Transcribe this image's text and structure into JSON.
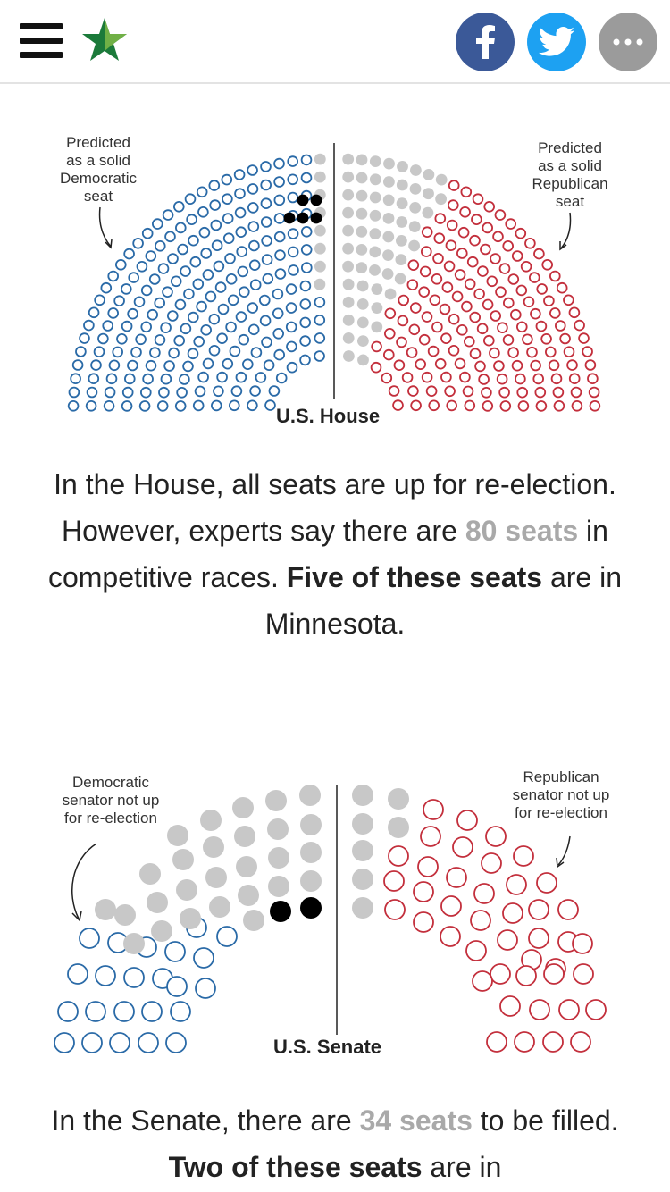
{
  "header": {
    "menu_icon": "hamburger-menu-icon",
    "logo_icon": "star-logo-icon",
    "share_buttons": [
      {
        "name": "facebook",
        "icon": "facebook-icon",
        "color": "#3b5998"
      },
      {
        "name": "twitter",
        "icon": "twitter-icon",
        "color": "#1da1f2"
      },
      {
        "name": "more",
        "icon": "more-icon",
        "color": "#9b9b9b"
      }
    ]
  },
  "colors": {
    "democrat": "#2a6aa7",
    "republican": "#c32f3c",
    "uncontested_blue_red": "#ffffff",
    "competitive": "#c8c8c8",
    "minnesota": "#000000"
  },
  "house": {
    "label": "U.S. House",
    "annotation_left": [
      "Predicted",
      "as a solid",
      "Democratic",
      "seat"
    ],
    "annotation_right": [
      "Predicted",
      "as a solid",
      "Republican",
      "seat"
    ],
    "seat_counts": {
      "democratic": 203,
      "competitive": 80,
      "minnesota_competitive": 5,
      "republican": 152
    }
  },
  "house_text": {
    "p1": "In the House, all seats are up for re-election. However, experts say there are ",
    "highlight": "80 seats",
    "p2": " in competitive races. ",
    "bold": "Five of these seats",
    "p3": " are in Minnesota."
  },
  "senate": {
    "label": "U.S. Senate",
    "annotation_left": [
      "Democratic",
      "senator not up",
      "for re-election"
    ],
    "annotation_right": [
      "Republican",
      "senator not up",
      "for re-election"
    ],
    "seat_counts": {
      "democratic_not_up": 23,
      "up_for_election": 34,
      "minnesota": 2,
      "republican_not_up": 43
    }
  },
  "senate_text": {
    "p1": "In the Senate, there are ",
    "highlight": "34 seats",
    "p2": " to be filled. ",
    "bold": "Two of these seats",
    "p3": " are in"
  }
}
